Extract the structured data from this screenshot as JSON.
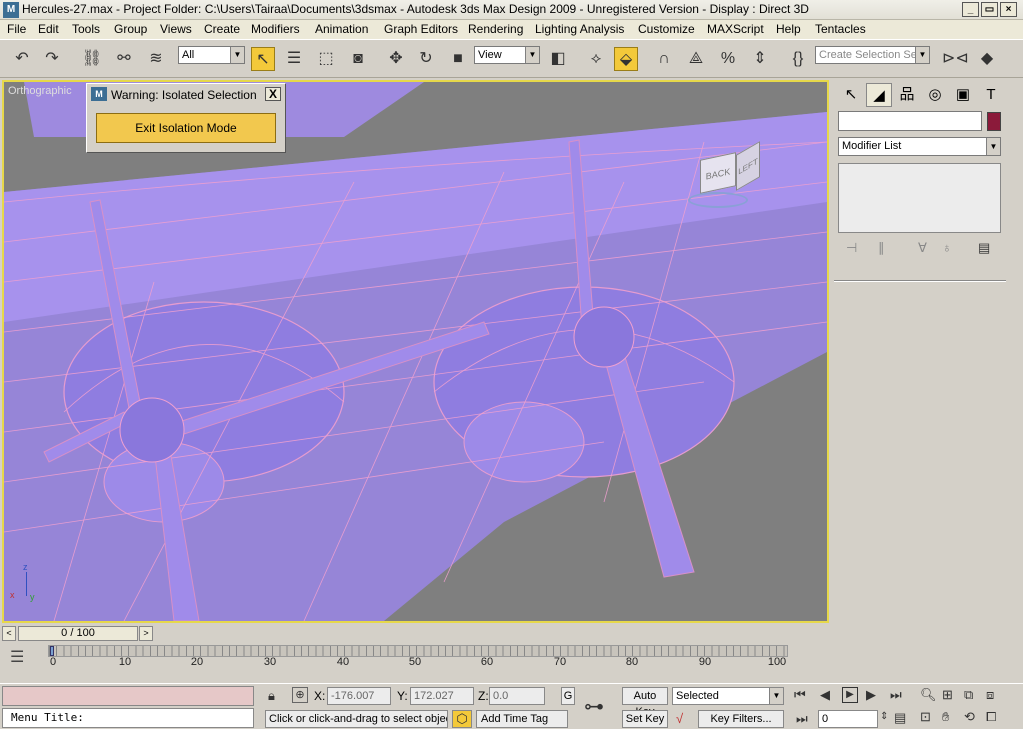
{
  "window": {
    "title": "Hercules-27.max    - Project Folder: C:\\Users\\Tairaa\\Documents\\3dsmax    - Autodesk 3ds Max Design 2009  - Unregistered Version    - Display : Direct 3D",
    "app_icon": "M",
    "min_label": "_",
    "max_label": "▭",
    "close_label": "×"
  },
  "menu": [
    "File",
    "Edit",
    "Tools",
    "Group",
    "Views",
    "Create",
    "Modifiers",
    "Animation",
    "Graph Editors",
    "Rendering",
    "Lighting Analysis",
    "Customize",
    "MAXScript",
    "Help",
    "Tentacles"
  ],
  "toolbar": {
    "selection_filter": "All",
    "reference_coord": "View",
    "named_selection_placeholder": "Create Selection Set"
  },
  "viewport": {
    "label": "Orthographic",
    "viewcube_back": "BACK",
    "viewcube_left": "LEFT",
    "axis_z": "z",
    "axis_x": "x",
    "axis_y": "y"
  },
  "isolation_dialog": {
    "title": "Warning: Isolated Selection",
    "button": "Exit Isolation Mode",
    "close": "X"
  },
  "command_panel": {
    "modifier_list": "Modifier List",
    "object_color": "#8b1a3a"
  },
  "timeline": {
    "slider_label": "0 / 100",
    "ticks": [
      "0",
      "10",
      "20",
      "30",
      "40",
      "50",
      "60",
      "70",
      "80",
      "90",
      "100"
    ]
  },
  "status": {
    "maxscript_label": "Menu Title:",
    "x_label": "X:",
    "x_value": "-176.007",
    "y_label": "Y:",
    "y_value": "172.027",
    "z_label": "Z:",
    "z_value": "0.0",
    "grid_label": "G",
    "prompt": "Click or click-and-drag to select object",
    "add_time_tag": "Add Time Tag",
    "auto_key": "Auto Key",
    "set_key": "Set Key",
    "key_mode": "Selected",
    "key_filters": "Key Filters...",
    "current_frame": "0"
  }
}
